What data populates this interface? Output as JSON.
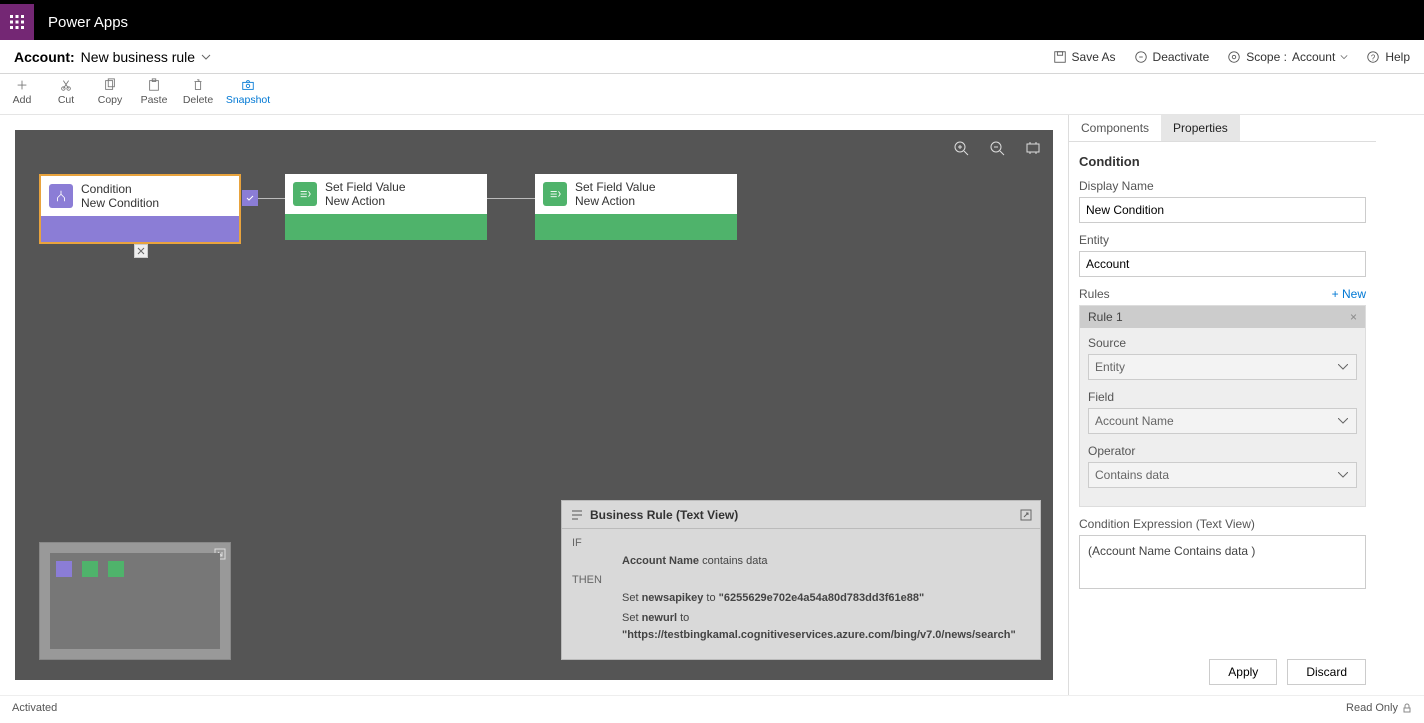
{
  "app": {
    "name": "Power Apps"
  },
  "breadcrumb": {
    "entity": "Account:",
    "rule": "New business rule"
  },
  "header_actions": {
    "saveas": "Save As",
    "deactivate": "Deactivate",
    "scope_label": "Scope :",
    "scope_value": "Account",
    "help": "Help"
  },
  "toolbar": {
    "add": "Add",
    "cut": "Cut",
    "copy": "Copy",
    "paste": "Paste",
    "delete": "Delete",
    "snapshot": "Snapshot"
  },
  "nodes": {
    "condition": {
      "title": "Condition",
      "sub": "New Condition"
    },
    "action1": {
      "title": "Set Field Value",
      "sub": "New Action"
    },
    "action2": {
      "title": "Set Field Value",
      "sub": "New Action"
    }
  },
  "textview": {
    "title": "Business Rule (Text View)",
    "if": "IF",
    "then": "THEN",
    "if_field": "Account Name",
    "if_rest": " contains data",
    "set1_pre": "Set ",
    "set1_field": "newsapikey",
    "set1_mid": " to ",
    "set1_val": "\"6255629e702e4a54a80d783dd3f61e88\"",
    "set2_pre": "Set ",
    "set2_field": "newurl",
    "set2_mid": " to ",
    "set2_val": "\"https://testbingkamal.cognitiveservices.azure.com/bing/v7.0/news/search\""
  },
  "panel": {
    "tab_components": "Components",
    "tab_properties": "Properties",
    "section": "Condition",
    "display_name_label": "Display Name",
    "display_name_value": "New Condition",
    "entity_label": "Entity",
    "entity_value": "Account",
    "rules_label": "Rules",
    "rules_new": "+ New",
    "rule1": "Rule 1",
    "source_label": "Source",
    "source_value": "Entity",
    "field_label": "Field",
    "field_value": "Account Name",
    "operator_label": "Operator",
    "operator_value": "Contains data",
    "expr_label": "Condition Expression (Text View)",
    "expr_value": "(Account Name Contains data )",
    "apply": "Apply",
    "discard": "Discard"
  },
  "status": {
    "left": "Activated",
    "right": "Read Only"
  }
}
